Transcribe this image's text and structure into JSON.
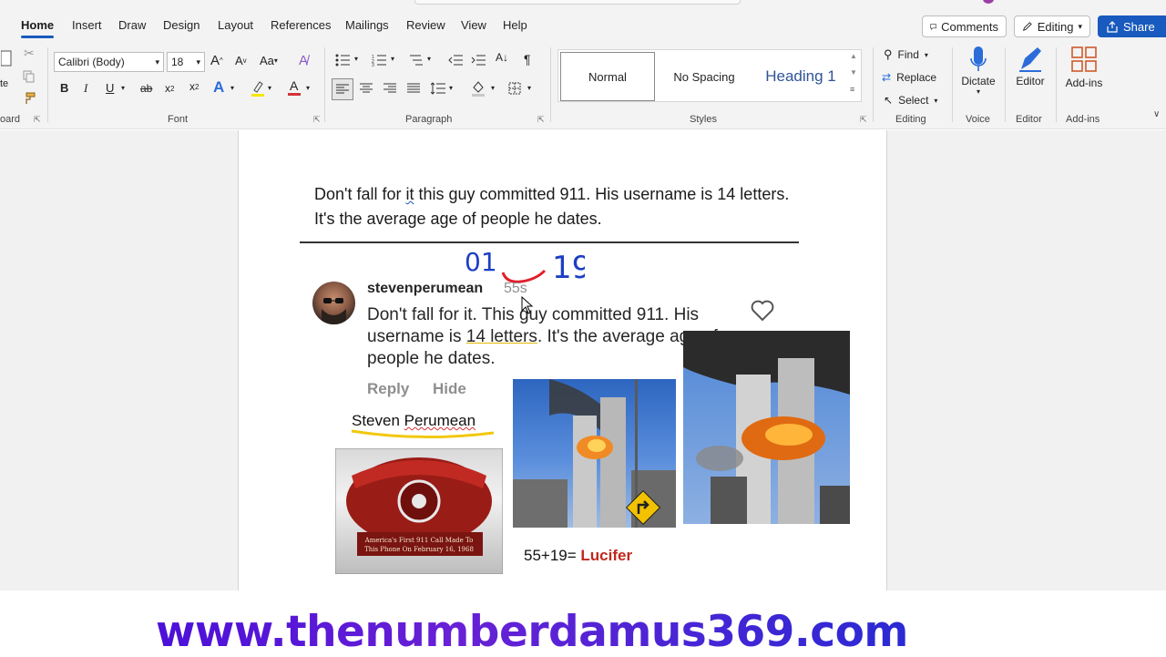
{
  "menu": {
    "tabs": [
      "Home",
      "Insert",
      "Draw",
      "Design",
      "Layout",
      "References",
      "Mailings",
      "Review",
      "View",
      "Help"
    ],
    "active_tab": "Home",
    "comments_label": "Comments",
    "editing_label": "Editing",
    "share_label": "Share"
  },
  "ribbon": {
    "clipboard_label": "oard",
    "paste_label": "te",
    "font_name": "Calibri (Body)",
    "font_size": "18",
    "font_group_label": "Font",
    "paragraph_group_label": "Paragraph",
    "styles_group_label": "Styles",
    "styles": [
      "Normal",
      "No Spacing",
      "Heading 1"
    ],
    "find_label": "Find",
    "replace_label": "Replace",
    "select_label": "Select",
    "editing_group_label": "Editing",
    "dictate_label": "Dictate",
    "voice_group_label": "Voice",
    "editor_label": "Editor",
    "editor_group_label": "Editor",
    "addins_label": "Add-ins",
    "addins_group_label": "Add-ins",
    "accent": "#185abd"
  },
  "document": {
    "text_part1": "Don't fall for ",
    "text_it": "it",
    "text_part2": " this guy committed 911. His username is 14 letters. It's the average age of people he dates."
  },
  "comment": {
    "username": "stevenperumean",
    "time": "55s",
    "text_a": "Don't fall for it. This guy committed 911. His username is ",
    "text_underlined": "14 letters",
    "text_b": ". It's the average age of people he dates.",
    "reply_label": "Reply",
    "hide_label": "Hide",
    "handwritten_left": "01",
    "handwritten_right": "19"
  },
  "annotation": {
    "name_first": "Steven ",
    "name_last": "Perumean",
    "phone_caption_line1": "America's First 911 Call Made To",
    "phone_caption_line2": "This Phone On February 16, 1968",
    "equation": "55+19= ",
    "equation_result": "Lucifer"
  },
  "footer": {
    "url": "www.thenumberdamus369.com"
  }
}
